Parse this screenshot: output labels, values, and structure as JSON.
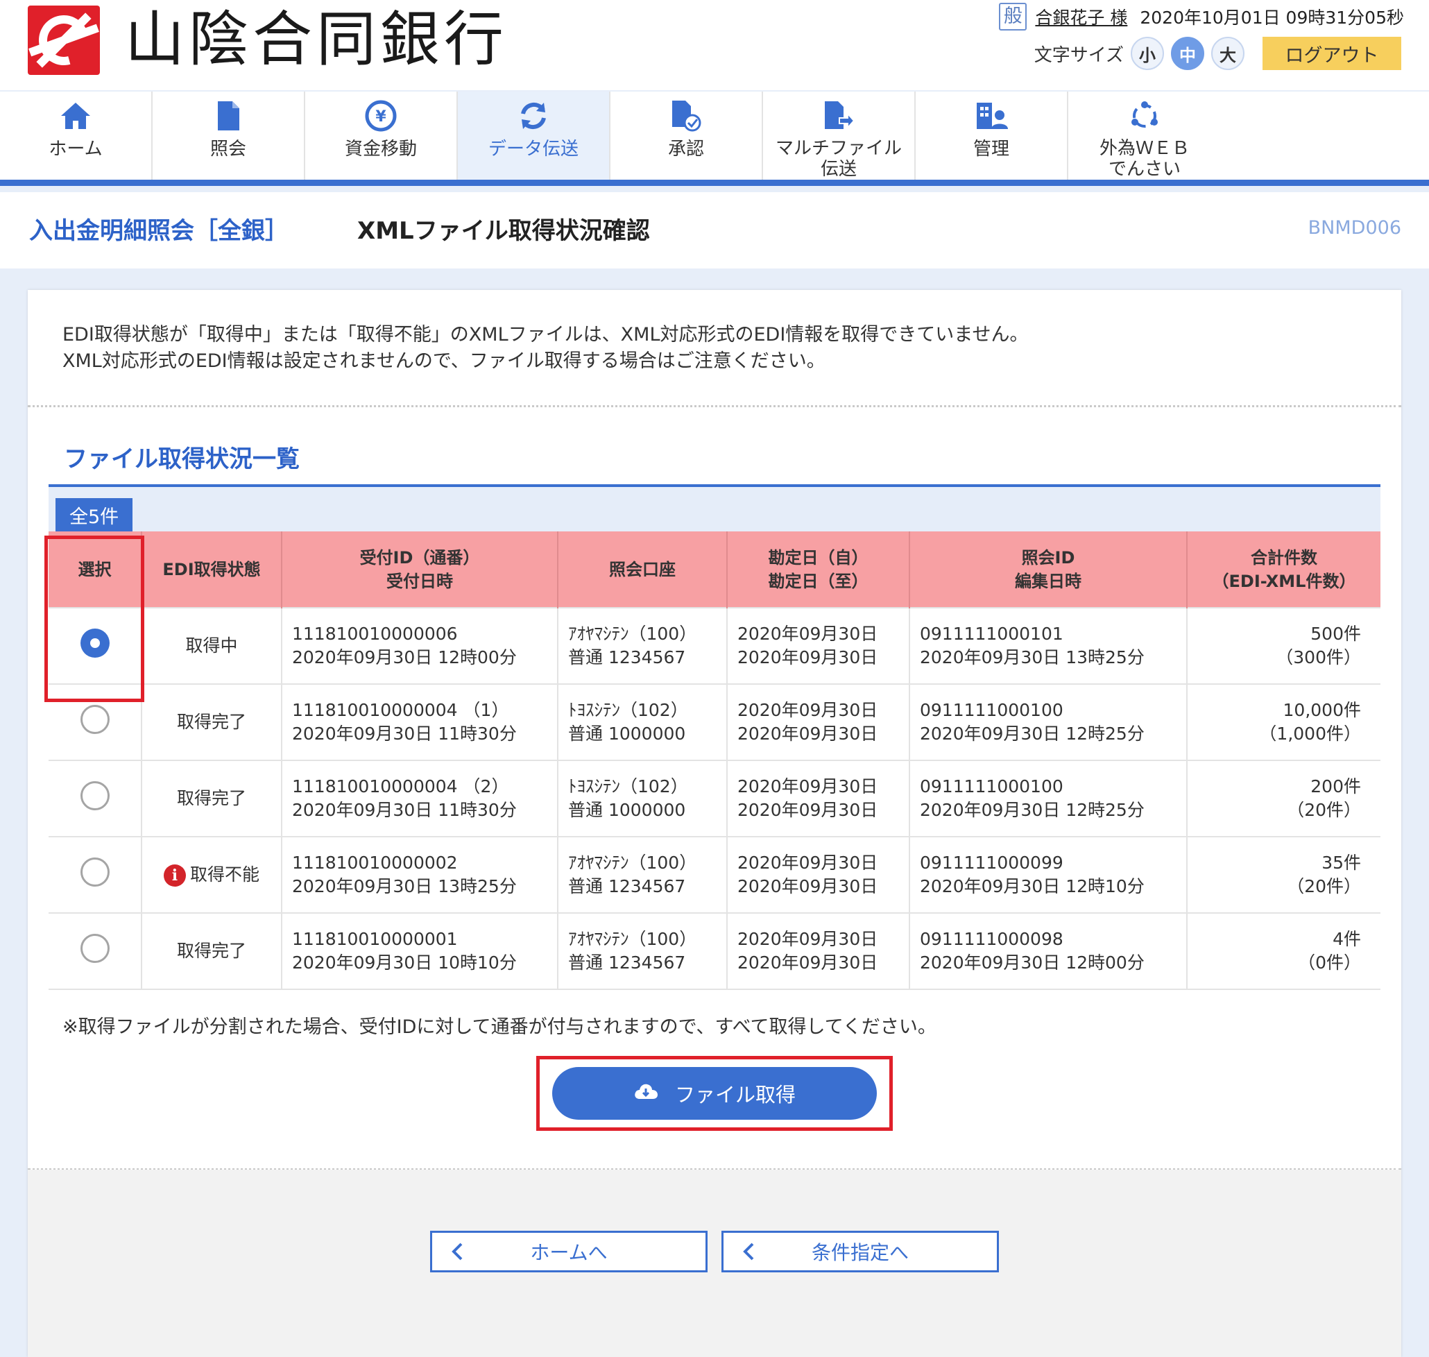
{
  "header": {
    "bank_name": "山陰合同銀行",
    "user_type": "般",
    "user_name": "合銀花子 様",
    "datetime": "2020年10月01日 09時31分05秒",
    "font_size_label": "文字サイズ",
    "font_sizes": [
      "小",
      "中",
      "大"
    ],
    "active_font_size": "中",
    "logout_label": "ログアウト"
  },
  "nav": {
    "items": [
      {
        "label": "ホーム",
        "icon": "home-icon"
      },
      {
        "label": "照会",
        "icon": "document-icon"
      },
      {
        "label": "資金移動",
        "icon": "yen-transfer-icon"
      },
      {
        "label": "データ伝送",
        "icon": "refresh-icon"
      },
      {
        "label": "承認",
        "icon": "approve-icon"
      },
      {
        "label": "マルチファイル\n伝送",
        "icon": "file-send-icon"
      },
      {
        "label": "管理",
        "icon": "admin-icon"
      },
      {
        "label": "外為ＷＥＢ\nでんさい",
        "icon": "network-icon"
      }
    ],
    "active": "データ伝送",
    "accent_color": "#3a6fd0"
  },
  "title_bar": {
    "category": "入出金明細照会［全銀］",
    "title": "XMLファイル取得状況確認",
    "screen_id": "BNMD006"
  },
  "notice": {
    "line1": "EDI取得状態が「取得中」または「取得不能」のXMLファイルは、XML対応形式のEDI情報を取得できていません。",
    "line2": "XML対応形式のEDI情報は設定されませんので、ファイル取得する場合はご注意ください。"
  },
  "section": {
    "title": "ファイル取得状況一覧",
    "count": "全5件"
  },
  "table": {
    "headers": [
      "選択",
      "EDI取得状態",
      "受付ID（通番）\n受付日時",
      "照会口座",
      "勘定日（自）\n勘定日（至）",
      "照会ID\n編集日時",
      "合計件数\n（EDI-XML件数）"
    ],
    "rows": [
      {
        "selected": true,
        "status": "取得中",
        "status_error": false,
        "receipt_id": "111810010000006",
        "receipt_time": "2020年09月30日 12時00分",
        "account_name": "ｱｵﾔﾏｼﾃﾝ（100）",
        "account_no": "普通 1234567",
        "date_from": "2020年09月30日",
        "date_to": "2020年09月30日",
        "inquiry_id": "0911111000101",
        "edit_time": "2020年09月30日 13時25分",
        "total": "500件",
        "xml_count": "（300件）"
      },
      {
        "selected": false,
        "status": "取得完了",
        "status_error": false,
        "receipt_id": "111810010000004 （1）",
        "receipt_time": "2020年09月30日 11時30分",
        "account_name": "ﾄﾖｽｼﾃﾝ（102）",
        "account_no": "普通 1000000",
        "date_from": "2020年09月30日",
        "date_to": "2020年09月30日",
        "inquiry_id": "0911111000100",
        "edit_time": "2020年09月30日 12時25分",
        "total": "10,000件",
        "xml_count": "（1,000件）"
      },
      {
        "selected": false,
        "status": "取得完了",
        "status_error": false,
        "receipt_id": "111810010000004 （2）",
        "receipt_time": "2020年09月30日 11時30分",
        "account_name": "ﾄﾖｽｼﾃﾝ（102）",
        "account_no": "普通 1000000",
        "date_from": "2020年09月30日",
        "date_to": "2020年09月30日",
        "inquiry_id": "0911111000100",
        "edit_time": "2020年09月30日 12時25分",
        "total": "200件",
        "xml_count": "（20件）"
      },
      {
        "selected": false,
        "status": "取得不能",
        "status_error": true,
        "receipt_id": "111810010000002",
        "receipt_time": "2020年09月30日 13時25分",
        "account_name": "ｱｵﾔﾏｼﾃﾝ（100）",
        "account_no": "普通 1234567",
        "date_from": "2020年09月30日",
        "date_to": "2020年09月30日",
        "inquiry_id": "0911111000099",
        "edit_time": "2020年09月30日 12時10分",
        "total": "35件",
        "xml_count": "（20件）"
      },
      {
        "selected": false,
        "status": "取得完了",
        "status_error": false,
        "receipt_id": "111810010000001",
        "receipt_time": "2020年09月30日 10時10分",
        "account_name": "ｱｵﾔﾏｼﾃﾝ（100）",
        "account_no": "普通 1234567",
        "date_from": "2020年09月30日",
        "date_to": "2020年09月30日",
        "inquiry_id": "0911111000098",
        "edit_time": "2020年09月30日 12時00分",
        "total": "4件",
        "xml_count": "（0件）"
      }
    ]
  },
  "footnote": "※取得ファイルが分割された場合、受付IDに対して通番が付与されますので、すべて取得してください。",
  "actions": {
    "file_get_label": "ファイル取得",
    "home_back_label": "ホームへ",
    "condition_back_label": "条件指定へ"
  },
  "colors": {
    "primary": "#3a6fd0",
    "header_row": "#f7a0a3",
    "highlight": "#e0202a",
    "logout": "#f7cf5d"
  }
}
